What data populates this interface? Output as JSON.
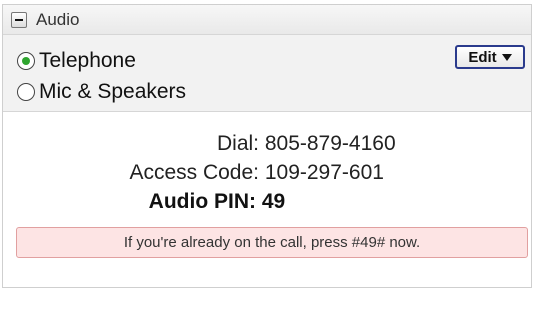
{
  "header": {
    "title": "Audio"
  },
  "audio_options": {
    "options": [
      {
        "label": "Telephone",
        "selected": true
      },
      {
        "label": "Mic & Speakers",
        "selected": false
      }
    ],
    "edit_label": "Edit"
  },
  "details": {
    "dial_label": "Dial:",
    "dial_value": "805-879-4160",
    "access_label": "Access Code:",
    "access_value": "109-297-601",
    "pin_label": "Audio PIN:",
    "pin_value": "49"
  },
  "notice": {
    "text": "If you're already on the call, press #49# now."
  },
  "colors": {
    "radio_selected": "#2fa52f",
    "edit_border": "#2a3a8c",
    "notice_bg": "#fde4e4",
    "notice_border": "#e1a0a0"
  },
  "icons": {
    "collapse": "minus-icon",
    "edit_dropdown": "caret-down-icon"
  }
}
